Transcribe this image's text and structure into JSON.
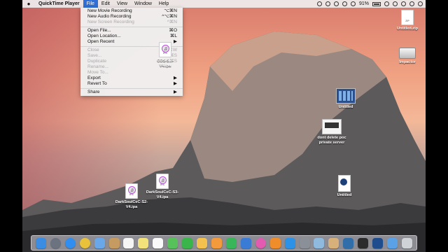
{
  "menubar": {
    "apple": "",
    "app_name": "QuickTime Player",
    "menus": [
      "File",
      "Edit",
      "View",
      "Window",
      "Help"
    ],
    "battery": "91%"
  },
  "file_menu": {
    "sections": [
      [
        {
          "label": "New Movie Recording",
          "shortcut": "⌥⌘N",
          "enabled": true
        },
        {
          "label": "New Audio Recording",
          "shortcut": "^⌥⌘N",
          "enabled": true
        },
        {
          "label": "New Screen Recording",
          "shortcut": "^⌘N",
          "enabled": false
        }
      ],
      [
        {
          "label": "Open File...",
          "shortcut": "⌘O",
          "enabled": true
        },
        {
          "label": "Open Location...",
          "shortcut": "⌘L",
          "enabled": true
        },
        {
          "label": "Open Recent",
          "shortcut": "▶",
          "enabled": true
        }
      ],
      [
        {
          "label": "Close",
          "shortcut": "⌘W",
          "enabled": false
        },
        {
          "label": "Save...",
          "shortcut": "⌘S",
          "enabled": false
        },
        {
          "label": "Duplicate",
          "shortcut": "⇧⌘S",
          "enabled": false
        },
        {
          "label": "Rename...",
          "shortcut": "",
          "enabled": false
        },
        {
          "label": "Move To...",
          "shortcut": "",
          "enabled": false
        },
        {
          "label": "Export",
          "shortcut": "▶",
          "enabled": true
        },
        {
          "label": "Revert To",
          "shortcut": "▶",
          "enabled": true
        }
      ],
      [
        {
          "label": "Share",
          "shortcut": "▶",
          "enabled": true
        }
      ]
    ]
  },
  "desktop": {
    "icons": [
      {
        "name": "Untitled.zip",
        "tag": "ZIP"
      },
      {
        "name": "Impactor",
        "tag": ""
      },
      {
        "name": "Untitled",
        "tag": ""
      },
      {
        "name": "dont delete poc private server",
        "tag": ""
      },
      {
        "name": "Untitled",
        "tag": "MOV"
      },
      {
        "name": "COS-5...-V4.ipa",
        "tag": "IPA"
      },
      {
        "name": "DarkSoulCeC-S2-V4.ipa",
        "tag": "IPA"
      },
      {
        "name": "DarkSoulCeC-S3-V4.ipa",
        "tag": "IPA"
      }
    ]
  },
  "dock": {
    "apps": [
      {
        "icon": "finder-icon",
        "color": "#3b8de3"
      },
      {
        "icon": "launchpad-icon",
        "color": "#6b7280"
      },
      {
        "icon": "safari-icon",
        "color": "#2f8ef0"
      },
      {
        "icon": "chrome-icon",
        "color": "#e8c23a"
      },
      {
        "icon": "mail-icon",
        "color": "#6aa7e8"
      },
      {
        "icon": "contacts-icon",
        "color": "#c69b62"
      },
      {
        "icon": "calendar-icon",
        "color": "#f5f5f5"
      },
      {
        "icon": "notes-icon",
        "color": "#f3e27a"
      },
      {
        "icon": "reminders-icon",
        "color": "#fafafa"
      },
      {
        "icon": "messages-icon",
        "color": "#58c25a"
      },
      {
        "icon": "facetime-icon",
        "color": "#3ab54a"
      },
      {
        "icon": "photos-icon",
        "color": "#f2c14e"
      },
      {
        "icon": "pages-icon",
        "color": "#f29a3c"
      },
      {
        "icon": "numbers-icon",
        "color": "#39b55a"
      },
      {
        "icon": "keynote-icon",
        "color": "#3a7bd5"
      },
      {
        "icon": "itunes-icon",
        "color": "#e25bb1"
      },
      {
        "icon": "ibooks-icon",
        "color": "#f08d2b"
      },
      {
        "icon": "appstore-icon",
        "color": "#2c92e8"
      },
      {
        "icon": "system-preferences-icon",
        "color": "#8a8f98"
      },
      {
        "icon": "preview-icon",
        "color": "#8fb9dd"
      },
      {
        "icon": "script-icon",
        "color": "#d7b07a"
      },
      {
        "icon": "xcode-icon",
        "color": "#2f6ea8"
      },
      {
        "icon": "terminal-icon",
        "color": "#2b2b2b"
      },
      {
        "icon": "quicktime-icon",
        "color": "#1f4c8c"
      },
      {
        "icon": "downloads-icon",
        "color": "#5aa1e6"
      },
      {
        "icon": "trash-icon",
        "color": "#cfd3d8"
      }
    ]
  }
}
